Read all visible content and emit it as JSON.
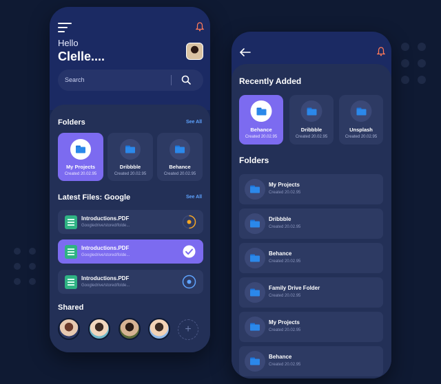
{
  "left_screen": {
    "greeting": "Hello",
    "username": "Clelle....",
    "search_placeholder": "Search",
    "folders_title": "Folders",
    "see_all_folders": "See All",
    "folders": [
      {
        "name": "My Projects",
        "date": "Created 20.02.95",
        "active": true
      },
      {
        "name": "Dribbble",
        "date": "Created 20.02.95",
        "active": false
      },
      {
        "name": "Behance",
        "date": "Created 20.02.95",
        "active": false
      }
    ],
    "latest_title": "Latest Files: Google",
    "see_all_files": "See All",
    "files": [
      {
        "name": "Introductions.PDF",
        "path": "Googledrive/stored/folde...",
        "status": "in-progress",
        "active": false
      },
      {
        "name": "Introductions.PDF",
        "path": "Googledrive/stored/folde...",
        "status": "done",
        "active": true
      },
      {
        "name": "Introductions.PDF",
        "path": "Googledrive/stored/folde...",
        "status": "pending",
        "active": false
      }
    ],
    "shared_title": "Shared",
    "add_shared_label": "+"
  },
  "right_screen": {
    "recent_title": "Recently Added",
    "recent": [
      {
        "name": "Behance",
        "date": "Created 20.02.95",
        "active": true
      },
      {
        "name": "Dribbble",
        "date": "Created 20.02.95",
        "active": false
      },
      {
        "name": "Unsplash",
        "date": "Created 20.02.95",
        "active": false
      }
    ],
    "folders_title": "Folders",
    "folders": [
      {
        "name": "My Projects",
        "date": "Created 20.02.95"
      },
      {
        "name": "Dribbble",
        "date": "Created 20.02.95"
      },
      {
        "name": "Behance",
        "date": "Created 20.02.95"
      },
      {
        "name": "Family Drive Folder",
        "date": "Created 20.02.95"
      },
      {
        "name": "My Projects",
        "date": "Created 20.02.95"
      },
      {
        "name": "Behance",
        "date": "Created 20.02.95"
      }
    ]
  },
  "colors": {
    "background": "#0f1a33",
    "card": "#2d3a63",
    "accent_purple": "#7c6bf0",
    "link_blue": "#5ea3ff",
    "file_green": "#2fb383",
    "status_orange": "#f5a623",
    "bell_orange": "#ff7a59"
  }
}
